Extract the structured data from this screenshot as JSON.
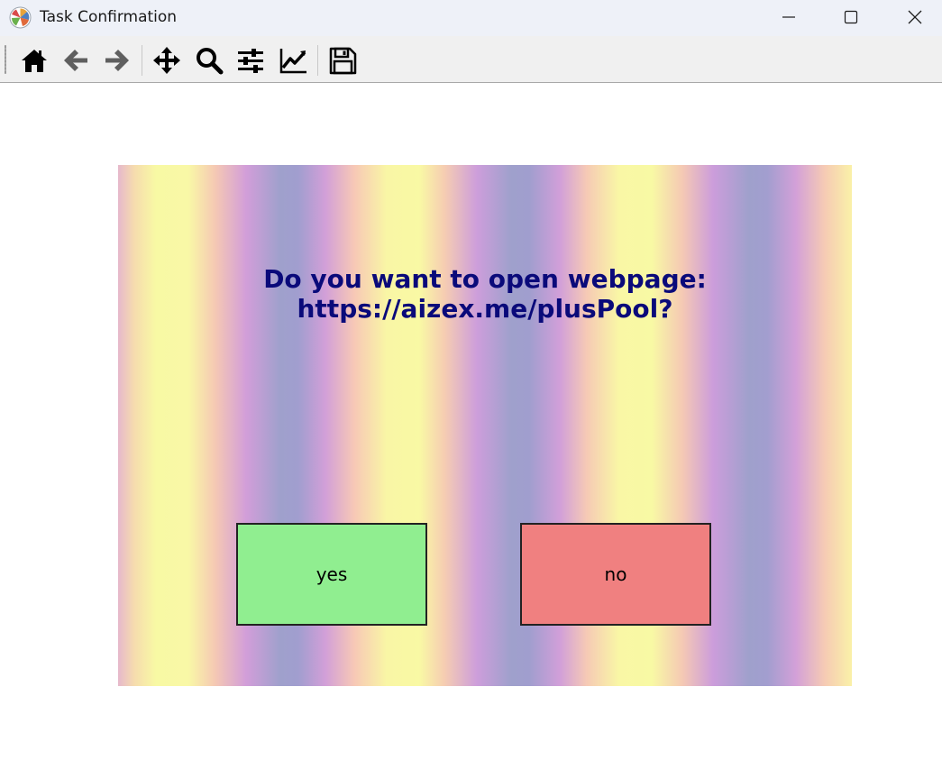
{
  "window": {
    "title": "Task Confirmation",
    "app_icon": "matplotlib-logo-icon",
    "controls": [
      "minimize-icon",
      "maximize-icon",
      "close-icon"
    ]
  },
  "toolbar": {
    "tools": [
      {
        "name": "home",
        "icon": "home-icon"
      },
      {
        "name": "back",
        "icon": "arrow-left-icon"
      },
      {
        "name": "forward",
        "icon": "arrow-right-icon"
      },
      {
        "name": "pan",
        "icon": "move-arrows-icon"
      },
      {
        "name": "zoom",
        "icon": "magnifier-icon"
      },
      {
        "name": "configure-subplots",
        "icon": "sliders-icon"
      },
      {
        "name": "edit-axis",
        "icon": "line-chart-icon"
      },
      {
        "name": "save",
        "icon": "floppy-disk-icon"
      }
    ]
  },
  "dialog": {
    "question_line1": "Do you want to open webpage:",
    "question_line2": "https://aizex.me/plusPool?",
    "yes_label": "yes",
    "no_label": "no"
  },
  "colors": {
    "titlebar": "#eef1f8",
    "toolbar": "#f0f0f0",
    "question_text": "#0a0a7a",
    "yes_button": "#90ee90",
    "no_button": "#f08080",
    "stripe_yellow": "#f8f9a4",
    "stripe_violet": "#9fa0cc",
    "stripe_pink": "#d29ed9"
  }
}
